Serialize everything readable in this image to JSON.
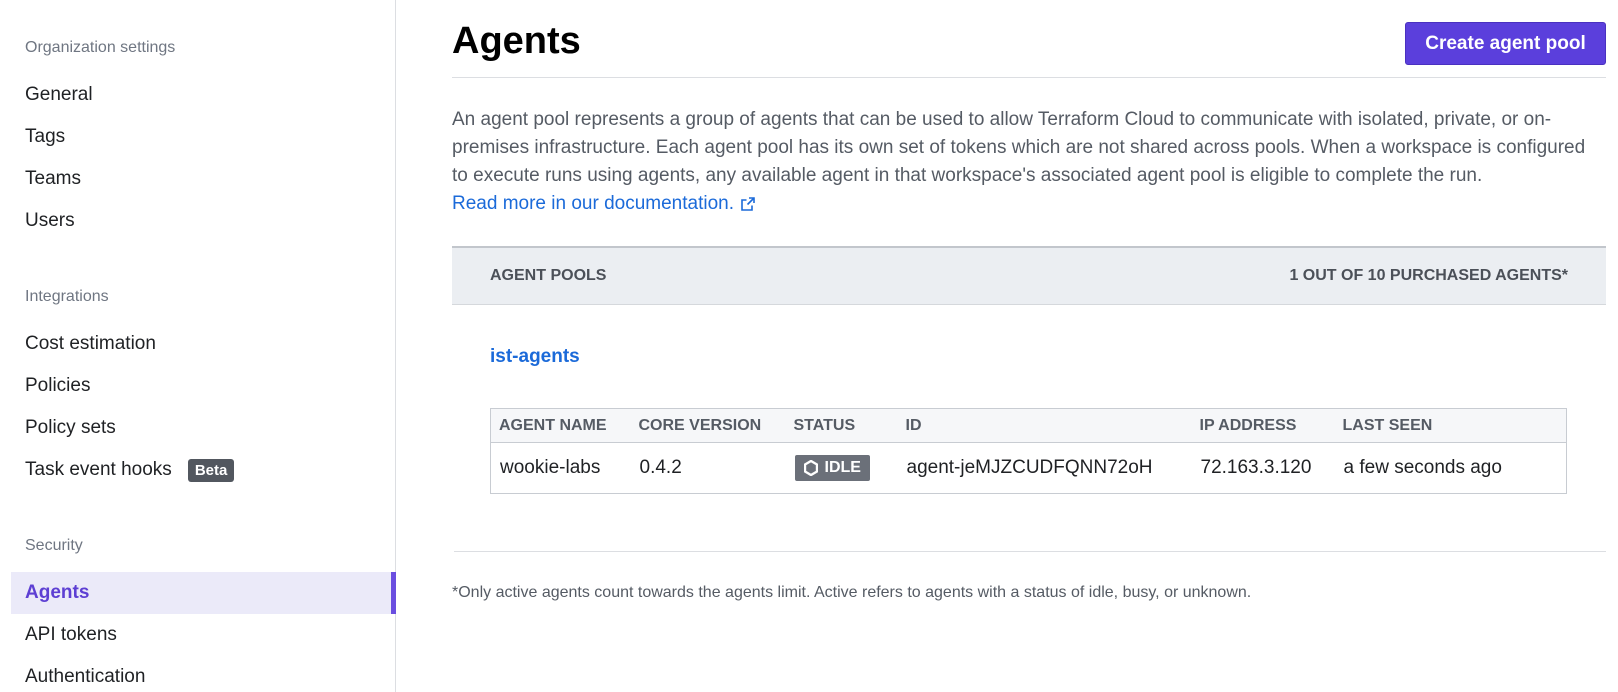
{
  "sidebar": {
    "org_label": "Organization settings",
    "org_items": [
      "General",
      "Tags",
      "Teams",
      "Users"
    ],
    "integrations_label": "Integrations",
    "integrations_items": [
      "Cost estimation",
      "Policies",
      "Policy sets",
      "Task event hooks"
    ],
    "beta_badge": "Beta",
    "security_label": "Security",
    "security_items": [
      "Agents",
      "API tokens",
      "Authentication"
    ],
    "active_item": "Agents"
  },
  "header": {
    "title": "Agents",
    "create_button": "Create agent pool"
  },
  "description": {
    "text": "An agent pool represents a group of agents that can be used to allow Terraform Cloud to communicate with isolated, private, or on-premises infrastructure. Each agent pool has its own set of tokens which are not shared across pools. When a workspace is configured to execute runs using agents, any available agent in that workspace's associated agent pool is eligible to complete the run.",
    "link": "Read more in our documentation."
  },
  "pools": {
    "header_label": "AGENT POOLS",
    "purchased_label": "1 OUT OF 10 PURCHASED AGENTS*",
    "pool_name": "ist-agents",
    "columns": [
      "AGENT NAME",
      "CORE VERSION",
      "STATUS",
      "ID",
      "IP ADDRESS",
      "LAST SEEN"
    ],
    "rows": [
      {
        "name": "wookie-labs",
        "version": "0.4.2",
        "status": "IDLE",
        "id": "agent-jeMJZCUDFQNN72oH",
        "ip": "72.163.3.120",
        "last_seen": "a few seconds ago"
      }
    ]
  },
  "footnote": "*Only active agents count towards the agents limit. Active refers to agents with a status of idle, busy, or unknown.",
  "colors": {
    "accent": "#5b3fdc",
    "link": "#1b6ad9",
    "status_idle": "#6b7079"
  }
}
